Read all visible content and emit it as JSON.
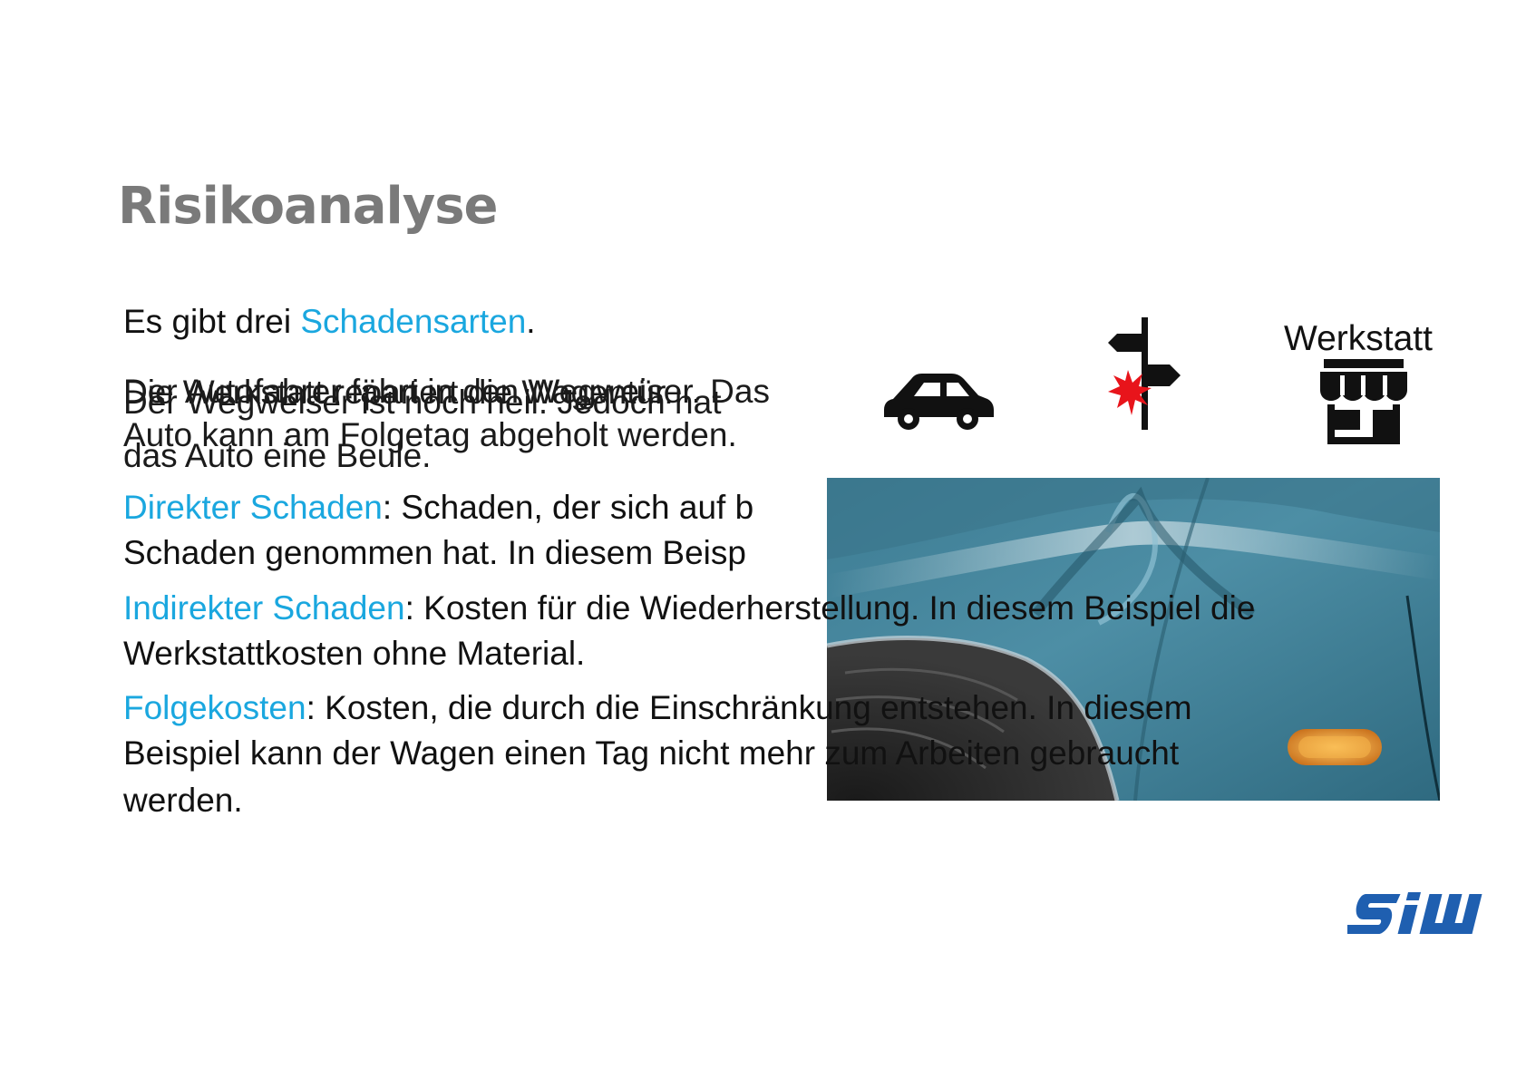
{
  "slide": {
    "title": "Risikoanalyse",
    "intro": {
      "prefix": "Es gibt drei ",
      "highlight": "Schadensarten",
      "suffix": "."
    },
    "overlapping_texts": [
      {
        "line1": "Der Autofahrer fährt in den Wegweiser. Das",
        "line2": "Auto kann am Folgetag abgeholt werden."
      },
      {
        "line1": "Die Werkstatt repariert die Wagentür.",
        "line2": ""
      },
      {
        "line1": "Der Wegweiser ist noch heil. Jedoch hat",
        "line2": "das Auto eine Beule."
      }
    ],
    "definitions": [
      {
        "term": "Direkter Schaden",
        "line1_rest": ": Schaden, der sich auf b",
        "line2": "Schaden genommen hat. In diesem Beisp"
      },
      {
        "term": "Indirekter Schaden",
        "line1_rest": ": Kosten für die Wiederherstellung. In diesem Beispiel die",
        "line2": "Werkstattkosten ohne Material."
      },
      {
        "term": "Folgekosten",
        "line1_rest": ": Kosten, die durch die Einschränkung entstehen. In diesem",
        "line2": "Beispiel kann der Wagen einen Tag nicht mehr zum Arbeiten gebraucht",
        "line3": "werden."
      }
    ],
    "icons": {
      "car": "car-icon",
      "signpost": "signpost-crash-icon",
      "workshop": "workshop-icon",
      "workshop_label": "Werkstatt"
    },
    "photo": "dented-car-door-photo",
    "logo": {
      "text": "SIW",
      "color": "#1f5fb0"
    },
    "colors": {
      "accent": "#1aa7df",
      "title": "#7a7a7a",
      "crash": "#e8141b"
    }
  }
}
